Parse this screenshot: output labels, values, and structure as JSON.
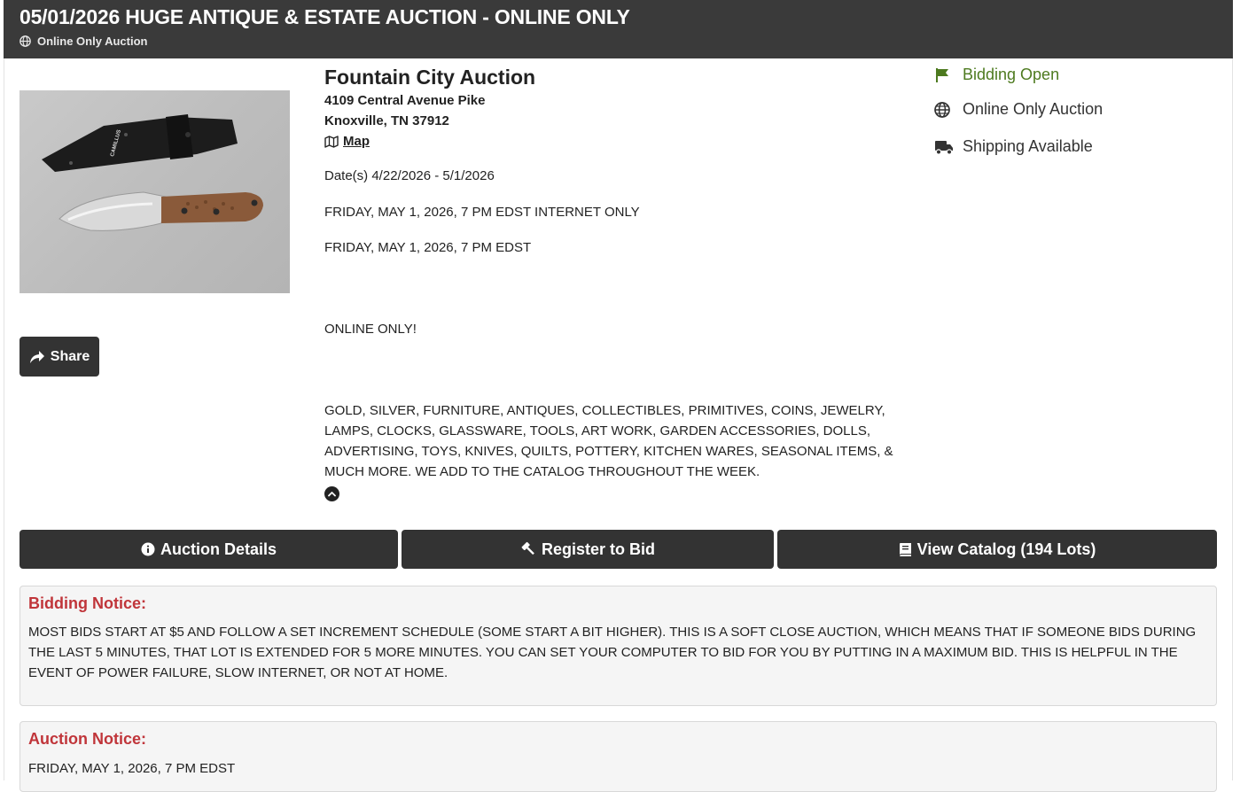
{
  "header": {
    "title": "05/01/2026 HUGE ANTIQUE & ESTATE AUCTION - ONLINE ONLY",
    "subtitle": "Online Only Auction",
    "subtitle_icon": "globe-icon"
  },
  "image": {
    "brand_text": "CAMILLUS"
  },
  "share": {
    "label": "Share",
    "icon": "share-arrow-icon"
  },
  "company": {
    "name": "Fountain City Auction",
    "address_line1": "4109 Central Avenue Pike",
    "address_line2": "Knoxville, TN 37912",
    "map_label": "Map",
    "map_icon": "map-icon"
  },
  "details": {
    "dates": "Date(s) 4/22/2026 - 5/1/2026",
    "line1": "FRIDAY, MAY 1, 2026, 7 PM EDST INTERNET ONLY",
    "line2": "FRIDAY, MAY 1, 2026, 7 PM EDST",
    "online": "ONLINE ONLY!",
    "description": "GOLD, SILVER, FURNITURE, ANTIQUES, COLLECTIBLES, PRIMITIVES, COINS, JEWELRY, LAMPS, CLOCKS, GLASSWARE, TOOLS, ART WORK, GARDEN ACCESSORIES, DOLLS, ADVERTISING, TOYS, KNIVES, QUILTS, POTTERY, KITCHEN WARES, SEASONAL ITEMS, & MUCH MORE. WE ADD TO THE CATALOG THROUGHOUT THE WEEK.",
    "collapse_icon": "chevron-up-icon"
  },
  "status": [
    {
      "label": "Bidding Open",
      "icon": "flag-icon",
      "color": "#4d7a1f"
    },
    {
      "label": "Online Only Auction",
      "icon": "globe-icon",
      "color": "#333333"
    },
    {
      "label": "Shipping Available",
      "icon": "truck-icon",
      "color": "#333333"
    }
  ],
  "actions": {
    "details_label": "Auction Details",
    "register_label": "Register to Bid",
    "catalog_label": "View Catalog (194 Lots)"
  },
  "notices": [
    {
      "title": "Bidding Notice:",
      "text": "MOST BIDS START AT $5 AND FOLLOW A SET INCREMENT SCHEDULE (SOME START A BIT HIGHER). THIS IS A SOFT CLOSE AUCTION, WHICH MEANS THAT IF SOMEONE BIDS DURING THE LAST 5 MINUTES, THAT LOT IS EXTENDED FOR 5 MORE MINUTES. YOU CAN SET YOUR COMPUTER TO BID FOR YOU BY PUTTING IN A MAXIMUM BID. THIS IS HELPFUL IN THE EVENT OF POWER FAILURE, SLOW INTERNET, OR NOT AT HOME."
    },
    {
      "title": "Auction Notice:",
      "text": "FRIDAY, MAY 1, 2026, 7 PM EDST"
    }
  ],
  "colors": {
    "header_bg": "#3a3a3a",
    "button_bg": "#333333",
    "notice_title": "#c0353a",
    "notice_bg": "#f5f5f5"
  }
}
